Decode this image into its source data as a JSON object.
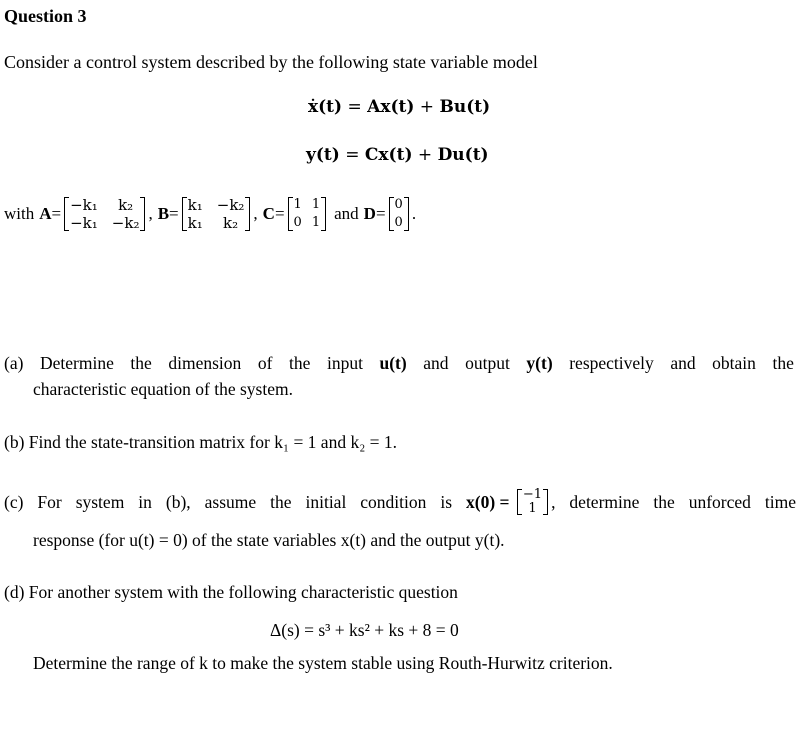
{
  "document": {
    "title": "Question 3",
    "intro": "Consider a control system described by the following state variable model",
    "equations": {
      "state": {
        "lhs": "ẋ(t)",
        "eq": " = ",
        "t1": "Ax(t)",
        "plus": " + ",
        "t2": "Bu(t)"
      },
      "output": {
        "lhs": "y(t)",
        "eq": " = ",
        "t1": "Cx(t)",
        "plus": " + ",
        "t2": "Du(t)"
      }
    },
    "matrices": {
      "with_label": "with",
      "A": {
        "name": "A",
        "cells": [
          "−k₁",
          "k₂",
          "−k₁",
          "−k₂"
        ]
      },
      "B": {
        "name": "B",
        "cells": [
          "k₁",
          "−k₂",
          "k₁",
          "k₂"
        ]
      },
      "C": {
        "name": "C",
        "cells": [
          "1",
          "1",
          "0",
          "1"
        ]
      },
      "D": {
        "name": "D",
        "cells": [
          "0",
          "0"
        ]
      },
      "and_label": "and",
      "eq_sign": " = ",
      "comma": ",",
      "period": "."
    },
    "parts": {
      "a": {
        "label": "(a)",
        "line1": [
          "Determine",
          "the",
          "dimension",
          "of",
          "the",
          "input",
          "u(t)",
          "and",
          "output",
          "y(t)",
          "respectively",
          "and",
          "obtain",
          "the"
        ],
        "line2": "characteristic equation of the system."
      },
      "b": {
        "text": "(b) Find the state-transition matrix for k₁ = 1 and k₂ = 1."
      },
      "c": {
        "line1_words": [
          "(c)",
          "For",
          "system",
          "in",
          "(b),",
          "assume",
          "the",
          "initial",
          "condition",
          "is"
        ],
        "x0_label": "x(0) = ",
        "x0_vector": [
          "−1",
          "1"
        ],
        "line1_tail_words": [
          ",",
          "determine",
          "the",
          "unforced",
          "time"
        ],
        "line2": "response (for u(t) = 0) of the state variables x(t) and the output y(t)."
      },
      "d": {
        "line1": "(d) For another system with the following characteristic question",
        "equation": "Δ(s) = s³ + ks² + ks + 8 = 0",
        "line3": "Determine the range of k to make the system stable using Routh-Hurwitz criterion."
      }
    }
  }
}
